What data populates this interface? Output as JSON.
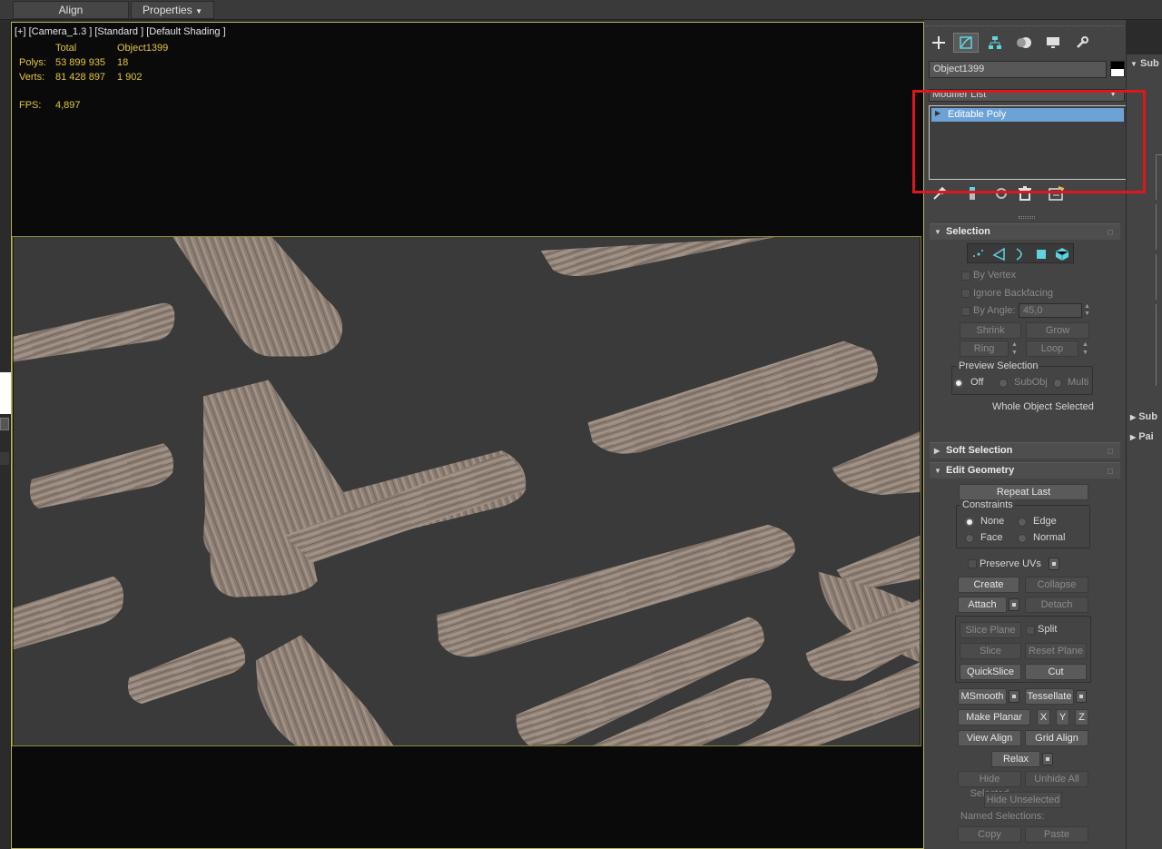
{
  "toolbar": {
    "align_label": "Align",
    "properties_label": "Properties"
  },
  "viewport": {
    "label": "[+] [Camera_1.3 ] [Standard ] [Default Shading ]",
    "stats": {
      "total_header": "Total",
      "object_header": "Object1399",
      "polys_label": "Polys:",
      "polys_total": "53 899 935",
      "polys_object": "18",
      "verts_label": "Verts:",
      "verts_total": "81 428 897",
      "verts_object": "1 902",
      "fps_label": "FPS:",
      "fps_value": "4,897"
    }
  },
  "command_panel": {
    "tabs": [
      "create-icon",
      "modify-icon",
      "hierarchy-icon",
      "motion-icon",
      "display-icon",
      "utilities-icon"
    ],
    "object_name": "Object1399",
    "object_color": "#000000",
    "modifier_list_label": "Modifier List",
    "stack_items": [
      "Editable Poly"
    ],
    "highlight_color": "#e0161c"
  },
  "selection": {
    "title": "Selection",
    "by_vertex": "By Vertex",
    "ignore_backfacing": "Ignore Backfacing",
    "by_angle": "By Angle:",
    "angle_value": "45,0",
    "shrink": "Shrink",
    "grow": "Grow",
    "ring": "Ring",
    "loop": "Loop",
    "preview_title": "Preview Selection",
    "preview_off": "Off",
    "preview_subobj": "SubObj",
    "preview_multi": "Multi",
    "status": "Whole Object Selected"
  },
  "soft_selection": {
    "title": "Soft Selection"
  },
  "edit_geometry": {
    "title": "Edit Geometry",
    "repeat_last": "Repeat Last",
    "constraints_title": "Constraints",
    "c_none": "None",
    "c_edge": "Edge",
    "c_face": "Face",
    "c_normal": "Normal",
    "preserve_uvs": "Preserve UVs",
    "create": "Create",
    "collapse": "Collapse",
    "attach": "Attach",
    "detach": "Detach",
    "slice_plane": "Slice Plane",
    "split": "Split",
    "slice": "Slice",
    "reset_plane": "Reset Plane",
    "quickslice": "QuickSlice",
    "cut": "Cut",
    "msmooth": "MSmooth",
    "tessellate": "Tessellate",
    "make_planar": "Make Planar",
    "x": "X",
    "y": "Y",
    "z": "Z",
    "view_align": "View Align",
    "grid_align": "Grid Align",
    "relax": "Relax",
    "hide_selected": "Hide Selected",
    "unhide_all": "Unhide All",
    "hide_unselected": "Hide Unselected",
    "named_selections": "Named Selections:",
    "copy": "Copy",
    "paste": "Paste"
  },
  "right_panel": {
    "sub1": "Sub",
    "sub2": "Sub",
    "pai": "Pai"
  }
}
